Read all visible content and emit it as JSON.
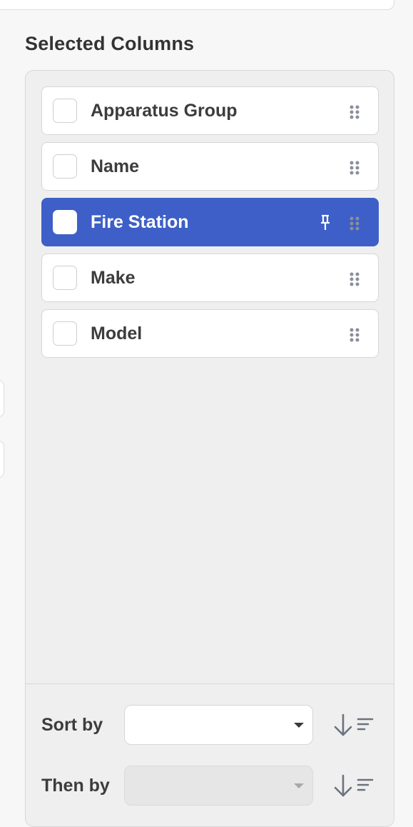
{
  "section_title": "Selected Columns",
  "columns": [
    {
      "label": "Apparatus Group",
      "selected": false,
      "pinned": false
    },
    {
      "label": "Name",
      "selected": false,
      "pinned": false
    },
    {
      "label": "Fire Station",
      "selected": true,
      "pinned": true
    },
    {
      "label": "Make",
      "selected": false,
      "pinned": false
    },
    {
      "label": "Model",
      "selected": false,
      "pinned": false
    }
  ],
  "sort": {
    "primary_label": "Sort by",
    "primary_value": "",
    "secondary_label": "Then by",
    "secondary_value": ""
  },
  "colors": {
    "accent": "#3d5fc7",
    "drag_dots": "#8a8f99",
    "sort_icon": "#6b7280"
  },
  "icons": [
    "drag-handle-icon",
    "pin-icon",
    "sort-descending-icon",
    "chevron-down-icon"
  ]
}
